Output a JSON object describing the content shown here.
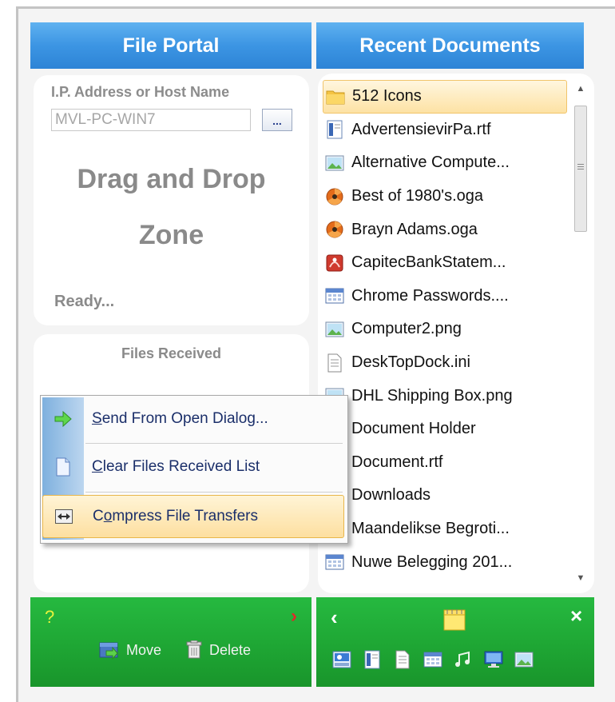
{
  "left_header": {
    "title": "File Portal"
  },
  "right_header": {
    "title": "Recent Documents"
  },
  "ip_panel": {
    "label": "I.P. Address or Host Name",
    "host_value": "MVL-PC-WIN7",
    "browse_label": "...",
    "drop_zone_line1": "Drag and Drop",
    "drop_zone_line2": "Zone",
    "status": "Ready..."
  },
  "files_panel": {
    "title": "Files Received"
  },
  "context_menu": {
    "items": [
      {
        "underline": "S",
        "rest": "end From Open Dialog...",
        "icon": "green-arrow-icon"
      },
      {
        "underline": "C",
        "rest": "lear Files Received List",
        "icon": "document-icon"
      },
      {
        "pre": "C",
        "underline": "o",
        "rest": "mpress File Transfers",
        "icon": "compress-icon",
        "highlighted": true
      }
    ]
  },
  "recent_documents": [
    {
      "name": "512 Icons",
      "icon": "folder-icon",
      "selected": true
    },
    {
      "name": "AdvertensievirPa.rtf",
      "icon": "rtf-doc-icon"
    },
    {
      "name": "Alternative Compute...",
      "icon": "image-file-icon"
    },
    {
      "name": "Best of 1980's.oga",
      "icon": "media-file-icon"
    },
    {
      "name": "Brayn Adams.oga",
      "icon": "media-file-icon"
    },
    {
      "name": "CapitecBankStatem...",
      "icon": "pdf-file-icon"
    },
    {
      "name": "Chrome Passwords....",
      "icon": "spreadsheet-file-icon"
    },
    {
      "name": "Computer2.png",
      "icon": "image-file-icon"
    },
    {
      "name": "DeskTopDock.ini",
      "icon": "text-file-icon"
    },
    {
      "name": "DHL Shipping Box.png",
      "icon": "image-file-icon"
    },
    {
      "name": "Document Holder",
      "icon": "folder-icon"
    },
    {
      "name": "Document.rtf",
      "icon": "rtf-doc-icon"
    },
    {
      "name": "Downloads",
      "icon": "folder-icon"
    },
    {
      "name": "Maandelikse Begroti...",
      "icon": "spreadsheet-file-icon"
    },
    {
      "name": "Nuwe Belegging 201...",
      "icon": "spreadsheet-file-icon"
    }
  ],
  "bottom_left": {
    "help_glyph": "?",
    "next_glyph": "›",
    "move_label": "Move",
    "delete_label": "Delete"
  },
  "bottom_right": {
    "back_glyph": "‹",
    "close_glyph": "×",
    "filter_icons": [
      "drive-icon",
      "rtf-doc-icon",
      "text-file-icon",
      "spreadsheet-file-icon",
      "music-file-icon",
      "monitor-icon",
      "image-file-icon"
    ]
  },
  "colors": {
    "header_blue": "#3c95e3",
    "bottom_green": "#1fa835",
    "help_yellow": "#e7f23c",
    "next_red": "#e2282a",
    "menu_text": "#1b2f6a"
  }
}
